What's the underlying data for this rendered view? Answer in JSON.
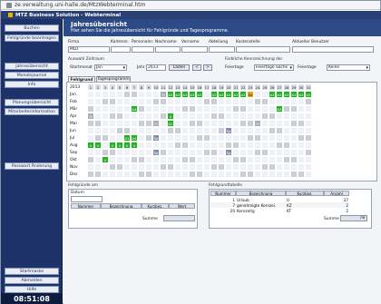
{
  "browser": {
    "url": "ze.verwaltung.uni-halle.de/MtzWebterminal.htm"
  },
  "app": {
    "title": "MTZ Business Solution - Webterminal"
  },
  "sidebar": {
    "top_buttons": [
      "Buchen",
      "Fehlgründe beantragen"
    ],
    "mid_buttons": [
      "Jahresübersicht",
      "Monatsjournal",
      "Info",
      "Planungsübersicht",
      "Mitarbeiterinformation"
    ],
    "password_button": "Passwort Änderung",
    "bottom_buttons": [
      "Startmaske",
      "Abmelden",
      "Hilfe"
    ],
    "clock": "08:51:08"
  },
  "header": {
    "title": "Jahresübersicht",
    "subtitle": "Hier sehen Sie die Jahresübersicht für Fehlgründe und Tagesprogramme."
  },
  "form": {
    "firma_label": "Firma",
    "kartennr_label": "Kartennr.",
    "personalnr_label": "Personalnr.",
    "nachname_label": "Nachname",
    "vorname_label": "Vorname",
    "abteilung_label": "Abteilung",
    "kostenstelle_label": "Kostenstelle",
    "benutzer_label": "Aktueller Benutzer",
    "firma_value": "MLU",
    "zeitraum_label": "Auswahl Zeitraum",
    "startmonat_label": "Startmonat",
    "startmonat_value": "Jan",
    "jahr_label": "Jahr",
    "jahr_value": "2013",
    "laden_button": "Laden",
    "prev_button": "<",
    "next_button": ">",
    "kennzeichnung_label": "Farbliche Kennzeichnung der",
    "feiertage_label": "Feiertage",
    "feiertage_value": "Feiertage Sachs",
    "feiertage2_label": "Feiertage",
    "feiertage2_value": "Keine"
  },
  "tabs": [
    "Fehlgrund",
    "Tagesprogramm"
  ],
  "calendar": {
    "year_label": "2013",
    "days": [
      "1",
      "2",
      "3",
      "4",
      "5",
      "6",
      "7",
      "8",
      "9",
      "10",
      "11",
      "12",
      "13",
      "14",
      "15",
      "16",
      "17",
      "18",
      "19",
      "20",
      "21",
      "22",
      "23",
      "24",
      "25",
      "26",
      "27",
      "28",
      "29",
      "30",
      "31"
    ],
    "months": [
      "Jan",
      "Feb",
      "Mär",
      "Apr",
      "Mai",
      "Jun",
      "Jul",
      "Aug",
      "Sep",
      "Okt",
      "Nov",
      "Dez"
    ],
    "rows": [
      [
        "",
        "",
        "",
        "",
        "",
        "",
        "",
        "",
        "",
        "",
        "Fr",
        "A2",
        "A2",
        "A2",
        "A2",
        "A2",
        "",
        "A2",
        "A2",
        "A2",
        "A2",
        "A2",
        "Ur",
        "",
        "",
        "A2",
        "A2",
        "A2",
        "A2",
        "A2",
        "A2"
      ],
      [
        "",
        "",
        "",
        "",
        "",
        "",
        "",
        "",
        "",
        "",
        "",
        "",
        "",
        "",
        "",
        "",
        "",
        "",
        "",
        "",
        "",
        "",
        "",
        "",
        "",
        "",
        "",
        "",
        "",
        "",
        ""
      ],
      [
        "",
        "",
        "",
        "",
        "",
        "",
        "A4",
        "",
        "",
        "",
        "",
        "",
        "",
        "",
        "",
        "",
        "",
        "",
        "",
        "",
        "",
        "",
        "",
        "",
        "",
        "",
        "KZ",
        "",
        "",
        "",
        ""
      ],
      [
        "Fr",
        "",
        "",
        "",
        "",
        "",
        "",
        "",
        "",
        "",
        "",
        "U",
        "",
        "",
        "",
        "",
        "",
        "",
        "",
        "",
        "",
        "",
        "",
        "",
        "",
        "",
        "",
        "",
        "",
        "",
        ""
      ],
      [
        "",
        "",
        "",
        "",
        "",
        "",
        "",
        "",
        "",
        "Fr",
        "",
        "A2",
        "",
        "",
        "",
        "",
        "",
        "",
        "",
        "",
        "",
        "",
        "",
        "Fr",
        "",
        "",
        "",
        "",
        "",
        "",
        ""
      ],
      [
        "",
        "",
        "",
        "",
        "",
        "",
        "",
        "",
        "",
        "",
        "",
        "",
        "",
        "",
        "",
        "",
        "",
        "",
        "",
        "Sp",
        "",
        "",
        "",
        "",
        "",
        "",
        "",
        "",
        "",
        "",
        ""
      ],
      [
        "",
        "",
        "",
        "",
        "",
        "A1",
        "A4",
        "",
        "",
        "Sp",
        "",
        "",
        "",
        "",
        "",
        "",
        "",
        "",
        "",
        "",
        "",
        "",
        "",
        "",
        "",
        "",
        "",
        "",
        "",
        "",
        ""
      ],
      [
        "U",
        "U",
        "",
        "U",
        "U",
        "U",
        "U",
        "",
        "",
        "",
        "",
        "",
        "",
        "",
        "",
        "",
        "",
        "",
        "",
        "",
        "",
        "",
        "",
        "",
        "",
        "",
        "",
        "",
        "",
        "",
        ""
      ],
      [
        "",
        "",
        "",
        "",
        "",
        "",
        "",
        "",
        "",
        "Sp",
        "",
        "",
        "",
        "",
        "",
        "",
        "",
        "",
        "",
        "Sp",
        "",
        "",
        "",
        "",
        "",
        "",
        "",
        "",
        "",
        "",
        ""
      ],
      [
        "",
        "",
        "U",
        "",
        "",
        "",
        "",
        "",
        "",
        "",
        "",
        "",
        "",
        "",
        "",
        "",
        "",
        "",
        "",
        "",
        "",
        "",
        "",
        "",
        "",
        "",
        "",
        "",
        "",
        "",
        ""
      ],
      [
        "",
        "",
        "",
        "",
        "",
        "",
        "",
        "",
        "",
        "",
        "",
        "",
        "",
        "",
        "",
        "",
        "",
        "",
        "",
        "",
        "",
        "",
        "",
        "",
        "",
        "",
        "",
        "",
        "",
        "",
        ""
      ],
      [
        "",
        "",
        "",
        "",
        "",
        "",
        "",
        "",
        "",
        "",
        "",
        "",
        "",
        "",
        "",
        "",
        "",
        "",
        "",
        "",
        "",
        "",
        "",
        "",
        "",
        "",
        "",
        "",
        "",
        "",
        ""
      ]
    ]
  },
  "fehlgruende": {
    "title": "Fehlgründe am",
    "datum_label": "Datum",
    "columns": [
      "Nummer",
      "Bezeichnung",
      "Kurzbez.",
      "Wert"
    ],
    "summe_label": "Summe"
  },
  "fehlgrundtabelle": {
    "title": "Fehlgrundtabelle",
    "columns": [
      "Nummer",
      "Bezeichnung",
      "Kurzbez.",
      "Anzahl"
    ],
    "rows": [
      [
        "1",
        "Urlaub",
        "U",
        "37"
      ],
      [
        "7",
        "genehmigte Kernzei.",
        "KZ",
        "2"
      ],
      [
        "20",
        "Kernzeitg",
        "KT",
        "2"
      ]
    ],
    "summe_label": "Summe",
    "summe_value": "78"
  },
  "colors": {
    "urlaub": "#18b818",
    "a2": "#18b818",
    "sp": "#7f90a8",
    "fr": "#a7adb9",
    "weekend": "#c9ced8",
    "highlight_red": "#b01818",
    "orange": "#e1a41e"
  }
}
